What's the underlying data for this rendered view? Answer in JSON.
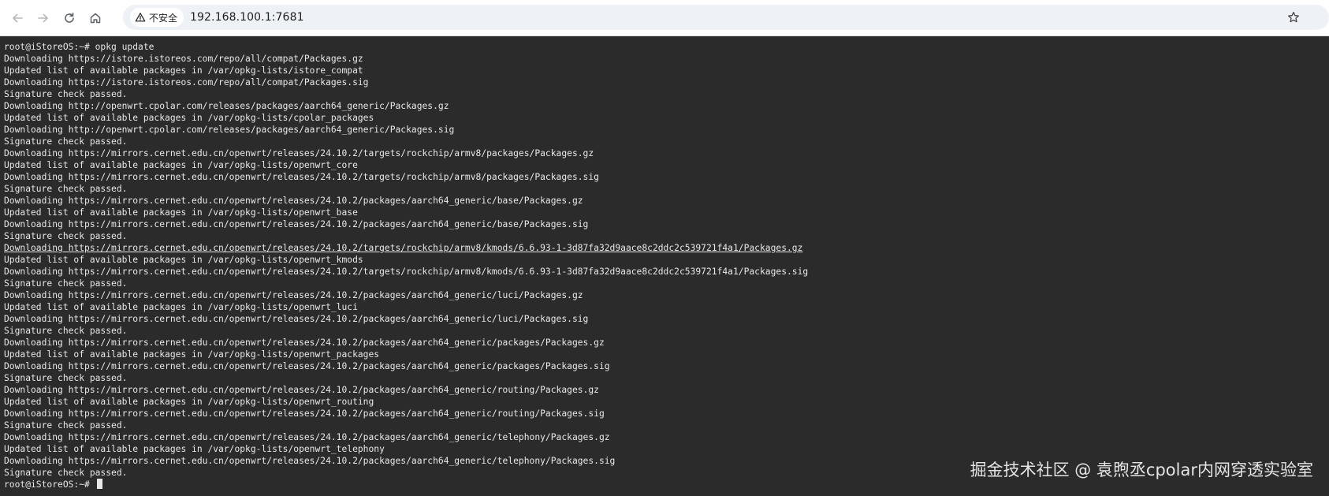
{
  "browser": {
    "security_label": "不安全",
    "url": "192.168.100.1:7681",
    "icons": {
      "back": "arrow-left-icon",
      "forward": "arrow-right-icon",
      "reload": "reload-icon",
      "home": "home-icon",
      "warning": "warning-triangle-icon",
      "bookmark": "star-outline-icon"
    }
  },
  "terminal": {
    "lines": [
      "root@iStoreOS:~# opkg update",
      "Downloading https://istore.istoreos.com/repo/all/compat/Packages.gz",
      "Updated list of available packages in /var/opkg-lists/istore_compat",
      "Downloading https://istore.istoreos.com/repo/all/compat/Packages.sig",
      "Signature check passed.",
      "Downloading http://openwrt.cpolar.com/releases/packages/aarch64_generic/Packages.gz",
      "Updated list of available packages in /var/opkg-lists/cpolar_packages",
      "Downloading http://openwrt.cpolar.com/releases/packages/aarch64_generic/Packages.sig",
      "Signature check passed.",
      "Downloading https://mirrors.cernet.edu.cn/openwrt/releases/24.10.2/targets/rockchip/armv8/packages/Packages.gz",
      "Updated list of available packages in /var/opkg-lists/openwrt_core",
      "Downloading https://mirrors.cernet.edu.cn/openwrt/releases/24.10.2/targets/rockchip/armv8/packages/Packages.sig",
      "Signature check passed.",
      "Downloading https://mirrors.cernet.edu.cn/openwrt/releases/24.10.2/packages/aarch64_generic/base/Packages.gz",
      "Updated list of available packages in /var/opkg-lists/openwrt_base",
      "Downloading https://mirrors.cernet.edu.cn/openwrt/releases/24.10.2/packages/aarch64_generic/base/Packages.sig",
      "Signature check passed.",
      "Downloading https://mirrors.cernet.edu.cn/openwrt/releases/24.10.2/targets/rockchip/armv8/kmods/6.6.93-1-3d87fa32d9aace8c2ddc2c539721f4a1/Packages.gz",
      "Updated list of available packages in /var/opkg-lists/openwrt_kmods",
      "Downloading https://mirrors.cernet.edu.cn/openwrt/releases/24.10.2/targets/rockchip/armv8/kmods/6.6.93-1-3d87fa32d9aace8c2ddc2c539721f4a1/Packages.sig",
      "Signature check passed.",
      "Downloading https://mirrors.cernet.edu.cn/openwrt/releases/24.10.2/packages/aarch64_generic/luci/Packages.gz",
      "Updated list of available packages in /var/opkg-lists/openwrt_luci",
      "Downloading https://mirrors.cernet.edu.cn/openwrt/releases/24.10.2/packages/aarch64_generic/luci/Packages.sig",
      "Signature check passed.",
      "Downloading https://mirrors.cernet.edu.cn/openwrt/releases/24.10.2/packages/aarch64_generic/packages/Packages.gz",
      "Updated list of available packages in /var/opkg-lists/openwrt_packages",
      "Downloading https://mirrors.cernet.edu.cn/openwrt/releases/24.10.2/packages/aarch64_generic/packages/Packages.sig",
      "Signature check passed.",
      "Downloading https://mirrors.cernet.edu.cn/openwrt/releases/24.10.2/packages/aarch64_generic/routing/Packages.gz",
      "Updated list of available packages in /var/opkg-lists/openwrt_routing",
      "Downloading https://mirrors.cernet.edu.cn/openwrt/releases/24.10.2/packages/aarch64_generic/routing/Packages.sig",
      "Signature check passed.",
      "Downloading https://mirrors.cernet.edu.cn/openwrt/releases/24.10.2/packages/aarch64_generic/telephony/Packages.gz",
      "Updated list of available packages in /var/opkg-lists/openwrt_telephony",
      "Downloading https://mirrors.cernet.edu.cn/openwrt/releases/24.10.2/packages/aarch64_generic/telephony/Packages.sig",
      "Signature check passed."
    ],
    "prompt": "root@iStoreOS:~# "
  },
  "watermark": "掘金技术社区 @ 袁煦丞cpolar内网穿透实验室",
  "colors": {
    "terminal_bg": "#2b2b2b",
    "terminal_fg": "#e8e8e8",
    "toolbar_bg": "#ffffff",
    "address_bg": "#eef1f6"
  }
}
